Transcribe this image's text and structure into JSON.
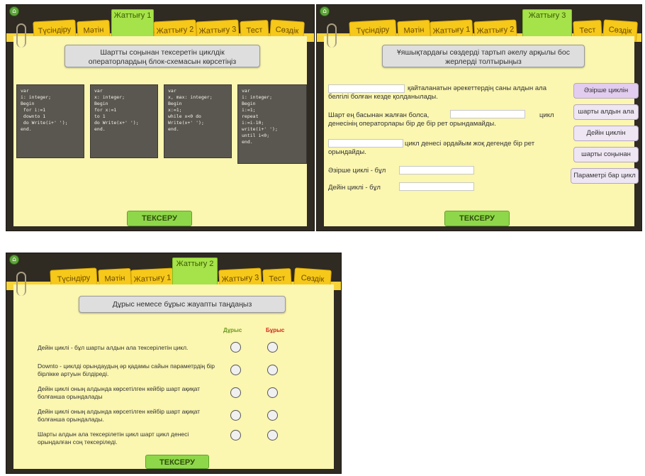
{
  "tabs_common": {
    "explain": "Түсіндіру",
    "text": "Мәтін",
    "ex1": "Жаттығу 1",
    "ex2": "Жаттығу 2",
    "ex3": "Жаттығу 3",
    "test": "Тест",
    "dict": "Сөздік"
  },
  "check_label": "ТЕКСЕРУ",
  "home_icon": "home-icon",
  "colors": {
    "frame": "#2f2a22",
    "page": "#fbf6b0",
    "tab": "#f6c81a",
    "tab_active": "#a6e24a",
    "check_button": "#8fd74a",
    "true_head": "#6a9a1e",
    "false_head": "#d8241c"
  },
  "screen1": {
    "instruction": "Шартты соңынан тексеретін циклдік операторлардың блок-схемасын көрсетіңіз",
    "codes": [
      "var\ni: integer;\nBegin\n for i:=1\n downto 1\n do Write(i+' ');\nend.",
      "var\nx: integer;\nBegin\nfor x:=1\nto 1\ndo Write(x+' ');\nend.",
      "var\nx, max: integer;\nBegin\nx:=1;\nwhile x<0 do\nWrite(x+' ');\nend.",
      "var\ni: integer;\nBegin\ni:=1;\nrepeat\ni:=i-10;\nwrite(i+' ');\nuntil i<0;\nend."
    ]
  },
  "screen2": {
    "instruction": "Ұяшықтардағы сөздерді тартып әкелу арқылы бос жерлерді толтырыңыз",
    "sentences": {
      "s1a": "қайталанатын әрекеттердің саны алдын ала",
      "s1b": "белгілі болған кезде қолданылады.",
      "s2a": "Шарт ең басынан жалған болса,",
      "s2b": "цикл",
      "s2c": "денесінің операторлары бір де бір рет орындамайды.",
      "s3a": "цикл денесі әрдайым жоқ дегенде бір рет",
      "s3b": "орындайды.",
      "s4": "Әзірше циклі - бұл",
      "s5": "Дейін циклі - бұл"
    },
    "words": [
      "Әзірше циклін",
      "шарты алдын ала",
      "Дейін циклін",
      "шарты соңынан",
      "Параметрі бар цикл"
    ]
  },
  "screen3": {
    "instruction": "Дұрыс немесе бұрыс жауапты таңдаңыз",
    "true_label": "Дұрыс",
    "false_label": "Бұрыс",
    "questions": [
      "Дейін циклі - бұл шарты алдын ала тексерілетін цикл.",
      "Downto - циклді орындаудың әр қадамы сайын параметрдің бір бірлікке артуын білдіреді.",
      "Дейін циклі оның алдында көрсетілген кейбір шарт ақиқат болғанша орындалады",
      "Дейін циклі оның алдында көрсетілген кейбір шарт ақиқат болғанша орындалады.",
      "Шарты алдын ала тексерілетін цикл шарт цикл денесі орындалған соң тексеріледі."
    ]
  }
}
